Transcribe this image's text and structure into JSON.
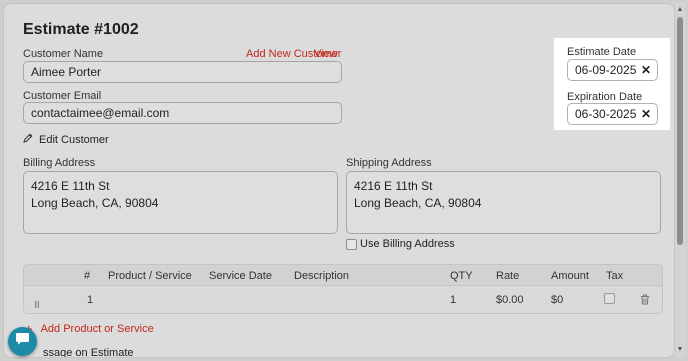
{
  "title": "Estimate #1002",
  "customer": {
    "name_label": "Customer Name",
    "add_new_label": "Add New Customer",
    "view_label": "View",
    "name_value": "Aimee Porter",
    "email_label": "Customer Email",
    "email_value": "contactaimee@email.com",
    "edit_label": "Edit Customer"
  },
  "dates": {
    "estimate_label": "Estimate Date",
    "estimate_value": "06-09-2025",
    "expiration_label": "Expiration Date",
    "expiration_value": "06-30-2025",
    "clear_glyph": "✕"
  },
  "billing": {
    "label": "Billing Address",
    "line1": "4216 E 11th St",
    "line2": "Long Beach, CA, 90804"
  },
  "shipping": {
    "label": "Shipping Address",
    "line1": "4216 E 11th St",
    "line2": "Long Beach, CA, 90804",
    "use_billing_label": "Use Billing Address"
  },
  "table": {
    "headers": [
      "#",
      "Product / Service",
      "Service Date",
      "Description",
      "QTY",
      "Rate",
      "Amount",
      "Tax"
    ],
    "row": {
      "index": "1",
      "qty": "1",
      "rate": "$0.00",
      "amount": "$0"
    }
  },
  "add_row_label": "Add Product or Service",
  "message_label": "ssage on Estimate",
  "colors": {
    "accent_red": "#c0281c",
    "chat_teal": "#1d8aa8"
  }
}
